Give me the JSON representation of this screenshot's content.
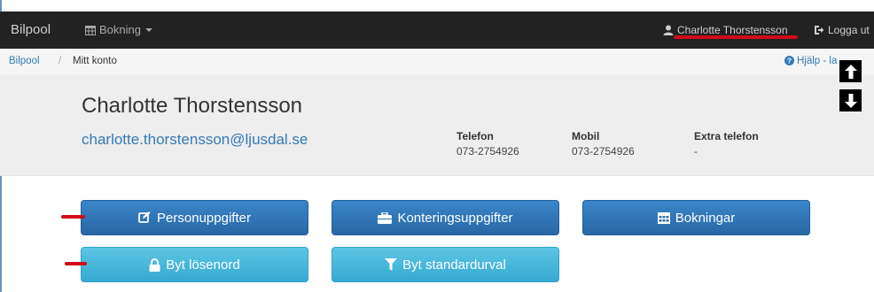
{
  "navbar": {
    "brand": "Bilpool",
    "booking_label": "Bokning",
    "user_name": "Charlotte Thorstensson",
    "logout_label": "Logga ut"
  },
  "breadcrumb": {
    "home": "Bilpool",
    "separator": "/",
    "current": "Mitt konto",
    "help": "Hjälp - la"
  },
  "profile": {
    "name": "Charlotte Thorstensson",
    "email": "charlotte.thorstensson@ljusdal.se",
    "phone_label": "Telefon",
    "phone_value": "073-2754926",
    "mobile_label": "Mobil",
    "mobile_value": "073-2754926",
    "extra_label": "Extra telefon",
    "extra_value": "-"
  },
  "buttons": {
    "personal": "Personuppgifter",
    "accounting": "Konteringsuppgifter",
    "bookings": "Bokningar",
    "password": "Byt lösenord",
    "default_filter": "Byt standardurval"
  },
  "colors": {
    "navbar": "#222222",
    "link": "#337ab7",
    "primary_button": "#2f74b5",
    "info_button": "#46b8da",
    "annotation": "#d10a1a"
  }
}
